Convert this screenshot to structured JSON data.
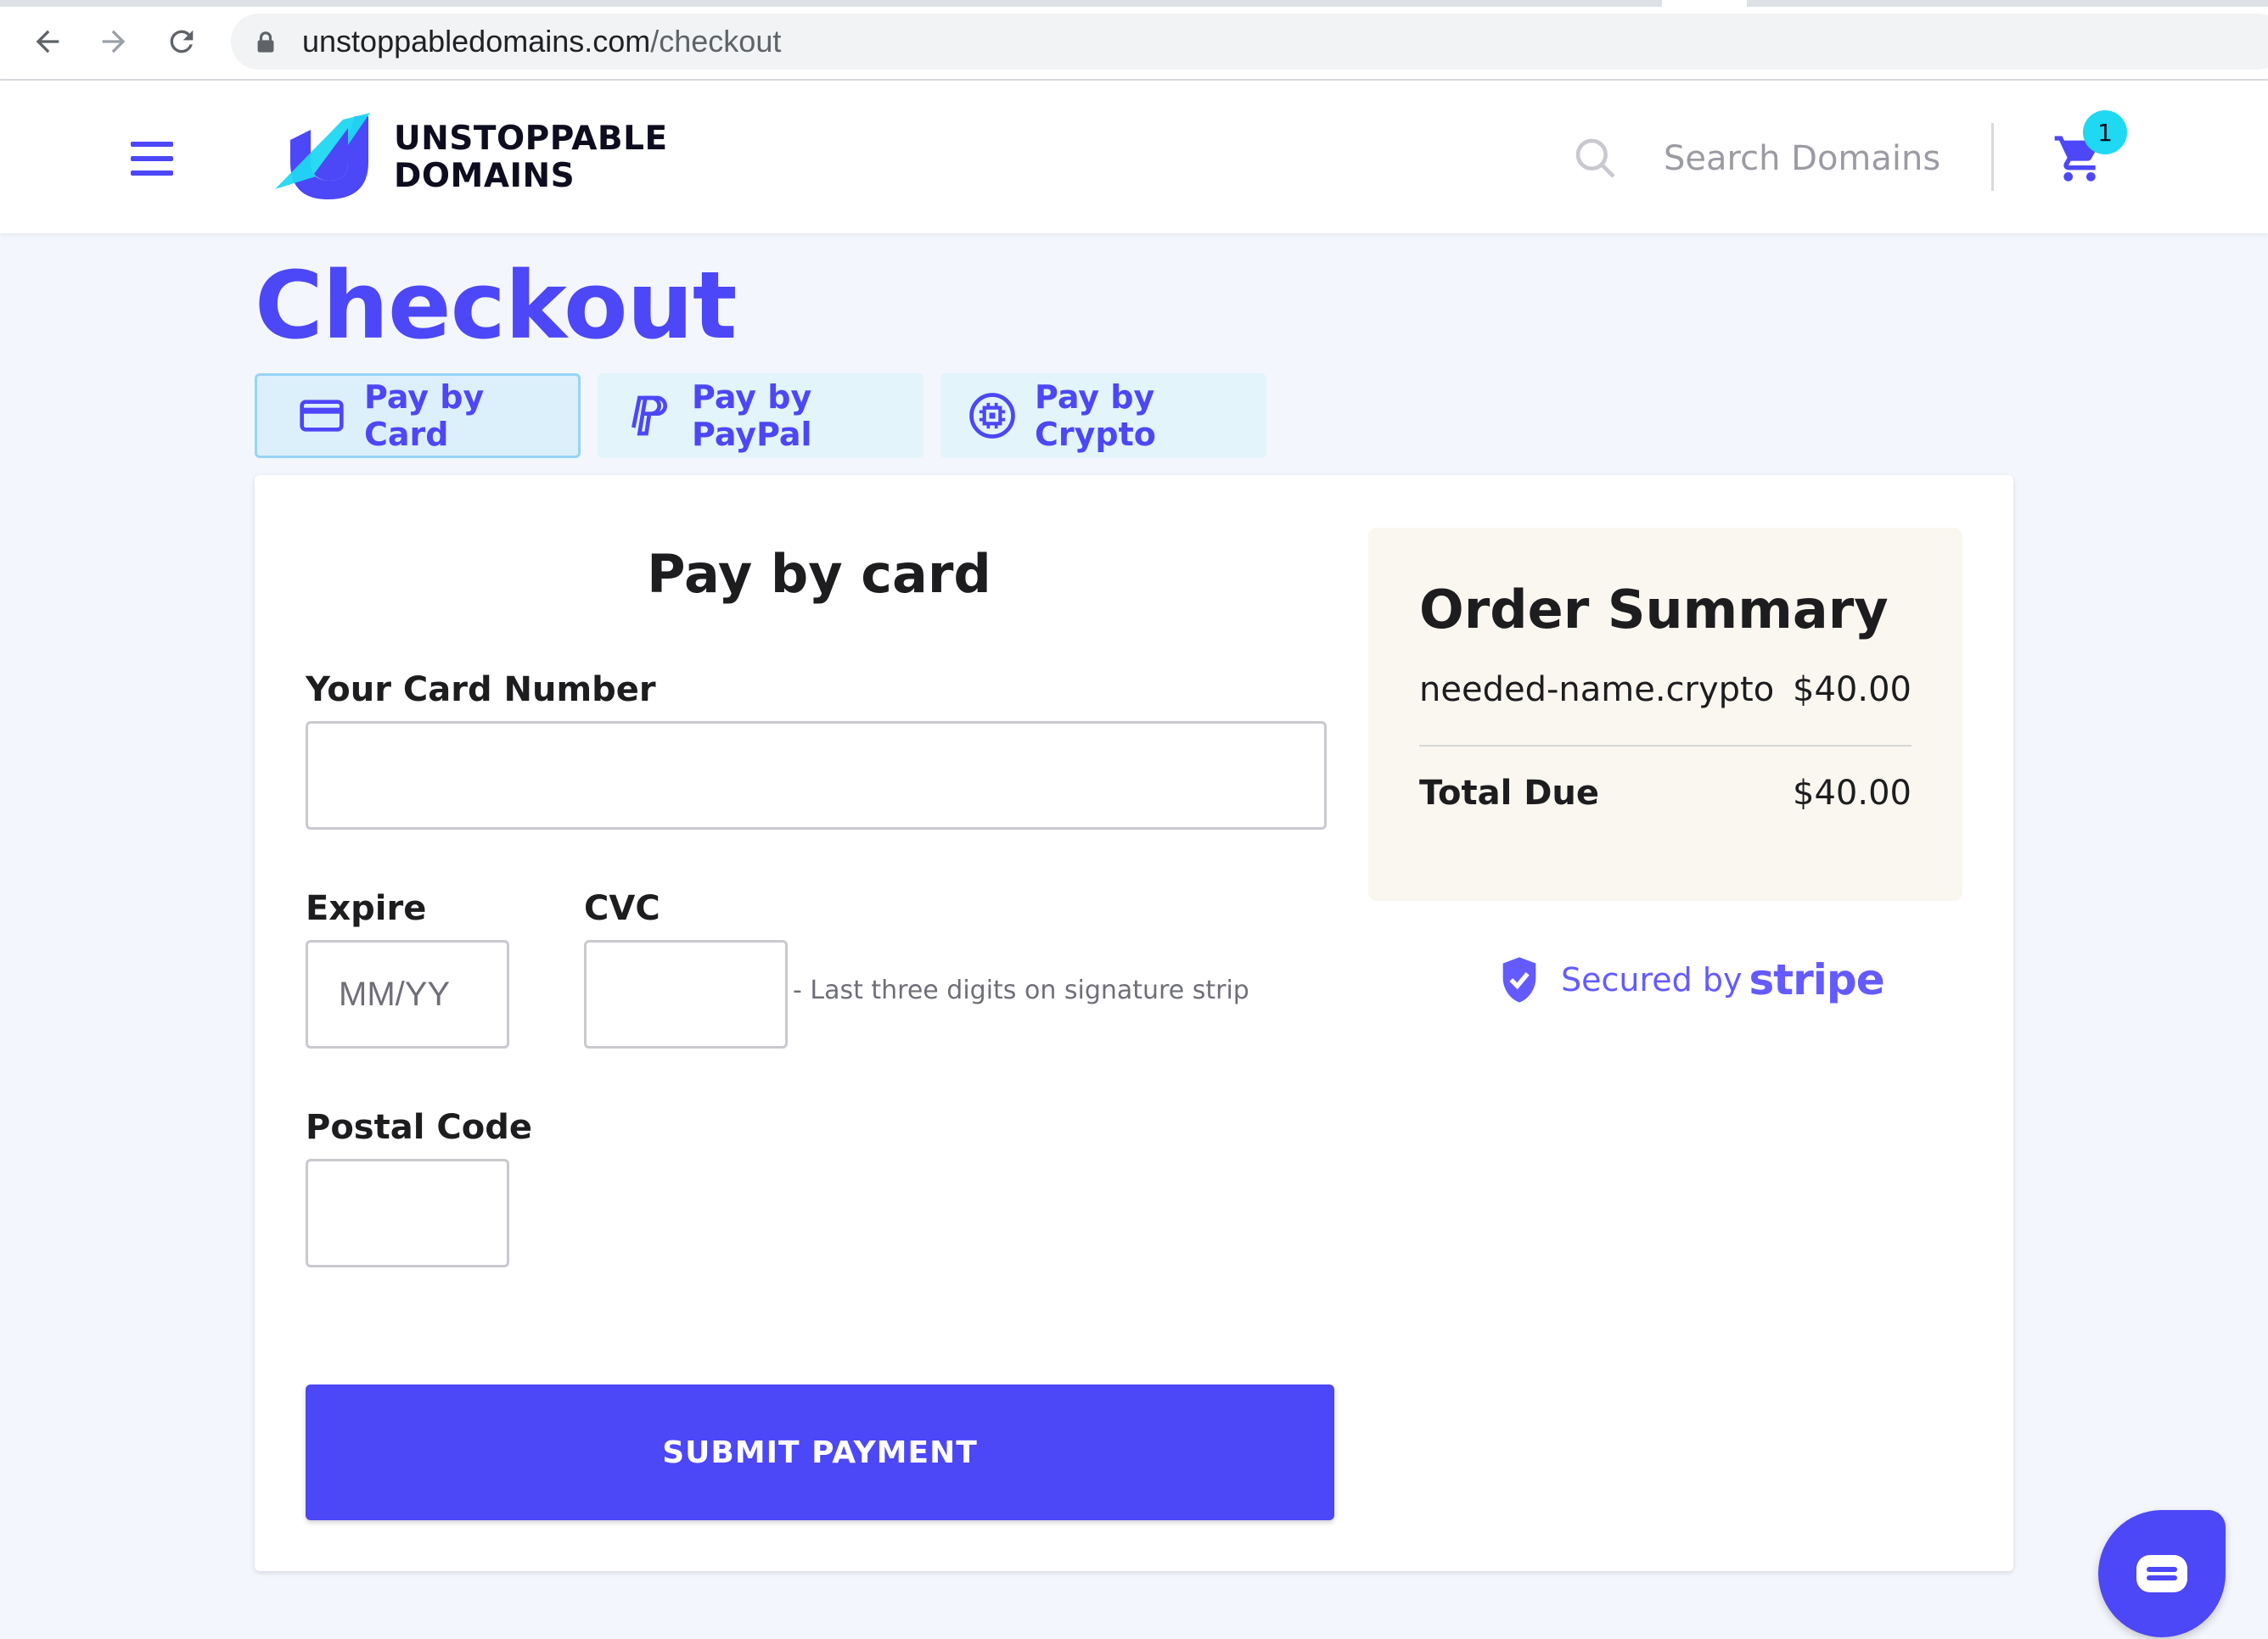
{
  "browser": {
    "url_domain": "unstoppabledomains.com",
    "url_path": "/checkout"
  },
  "header": {
    "logo_line1": "UNSTOPPABLE",
    "logo_line2": "DOMAINS",
    "search_placeholder": "Search Domains",
    "cart_count": "1"
  },
  "page": {
    "title": "Checkout"
  },
  "tabs": [
    {
      "label": "Pay by Card",
      "icon": "credit-card-icon",
      "active": true
    },
    {
      "label": "Pay by PayPal",
      "icon": "paypal-icon",
      "active": false
    },
    {
      "label": "Pay by Crypto",
      "icon": "crypto-chip-icon",
      "active": false
    }
  ],
  "form": {
    "title": "Pay by card",
    "card_number_label": "Your Card Number",
    "card_number_value": "",
    "expire_label": "Expire",
    "expire_placeholder": "MM/YY",
    "cvc_label": "CVC",
    "cvc_value": "",
    "cvc_hint": "- Last three digits on signature strip",
    "postal_label": "Postal Code",
    "postal_value": "",
    "submit_label": "SUBMIT PAYMENT"
  },
  "summary": {
    "title": "Order Summary",
    "item_name": "needed-name.crypto",
    "item_price": "$40.00",
    "total_label": "Total Due",
    "total_amount": "$40.00"
  },
  "security": {
    "secured_by": "Secured by",
    "provider": "stripe"
  },
  "colors": {
    "brand": "#4c47f7",
    "accent_cyan": "#1fd8f2",
    "stripe": "#635bff",
    "summary_bg": "#f9f7f0"
  }
}
